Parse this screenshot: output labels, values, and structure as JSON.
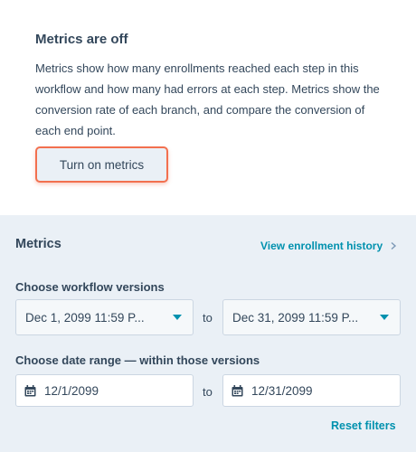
{
  "metrics_off": {
    "title": "Metrics are off",
    "description": "Metrics show how many enrollments reached each step in this workflow and how many had errors at each step. Metrics show the conversion rate of each branch, and compare the conversion of each end point.",
    "button_label": "Turn on metrics"
  },
  "metrics": {
    "title": "Metrics",
    "history_link": "View enrollment history",
    "versions_label": "Choose workflow versions",
    "version_from": "Dec 1, 2099 11:59 P...",
    "version_to": "Dec 31, 2099 11:59 P...",
    "to_text": "to",
    "date_range_label": "Choose date range — within those versions",
    "date_from": "12/1/2099",
    "date_to": "12/31/2099",
    "reset_label": "Reset filters"
  },
  "colors": {
    "accent_link": "#0091ae",
    "highlight": "#f2704f",
    "text": "#33475b",
    "panel_bg": "#eaf0f6"
  },
  "icons": {
    "link_chevron": "chevron-right-icon",
    "dropdown": "caret-down-icon",
    "date": "calendar-icon"
  }
}
